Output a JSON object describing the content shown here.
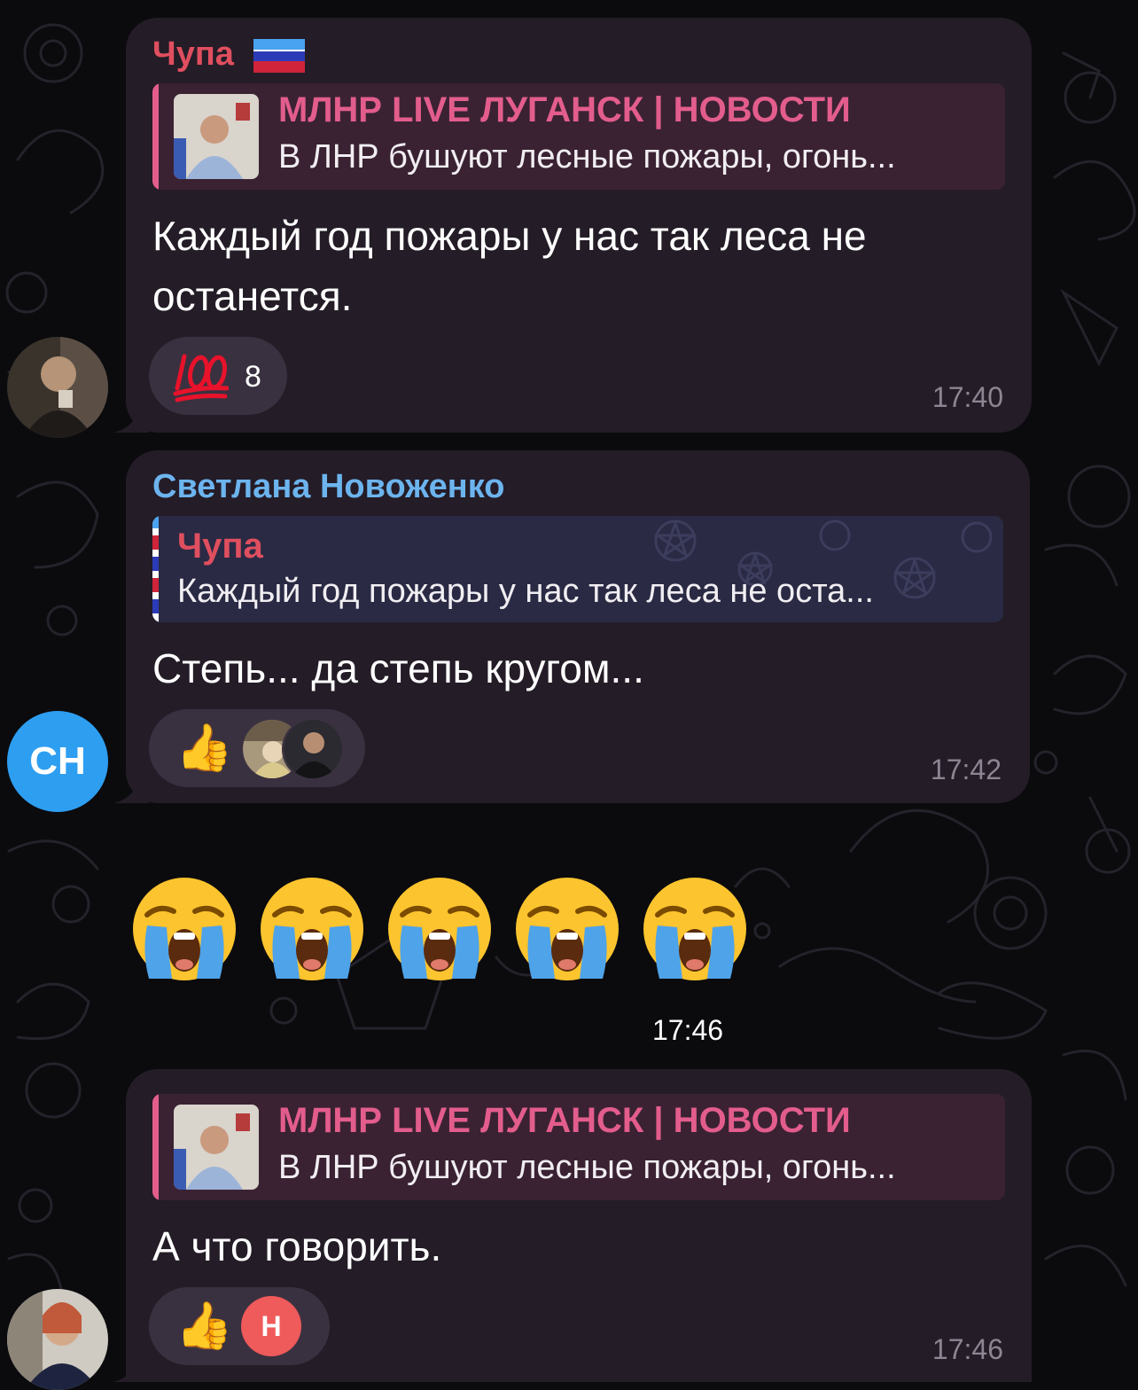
{
  "colors": {
    "bubble": "#241c27",
    "sender_red": "#e04f5f",
    "sender_blue": "#6cb4ee",
    "channel_pink": "#e35d8c",
    "timestamp": "#8e8593",
    "reaction_bg": "#3a3140",
    "ch_avatar": "#2e9ef1",
    "n_avatar": "#ef5a5a"
  },
  "messages": [
    {
      "sender": "Чупа",
      "sender_flag": "flag-lnr-icon",
      "reply": {
        "title": "МЛНР LIVE ЛУГАНСК | НОВОСТИ",
        "text": "В ЛНР бушуют лесные пожары, огонь..."
      },
      "text": "Каждый год пожары у нас так леса не останется.",
      "reaction": {
        "emoji": "💯",
        "count": "8"
      },
      "time": "17:40"
    },
    {
      "sender": "Светлана Новоженко",
      "avatar_initials": "СН",
      "reply": {
        "title": "Чупа",
        "text": "Каждый год пожары у нас так леса не оста..."
      },
      "text": "Степь... да степь кругом...",
      "reaction": {
        "emoji": "👍"
      },
      "time": "17:42"
    },
    {
      "emoji_count": 5,
      "emoji": "loudly-crying-face-icon",
      "time": "17:46"
    },
    {
      "reply": {
        "title": "МЛНР LIVE ЛУГАНСК | НОВОСТИ",
        "text": "В ЛНР бушуют лесные пожары, огонь..."
      },
      "text": "А что говорить.",
      "reaction": {
        "emoji": "👍",
        "avatar_initial": "Н"
      },
      "time": "17:46"
    }
  ]
}
